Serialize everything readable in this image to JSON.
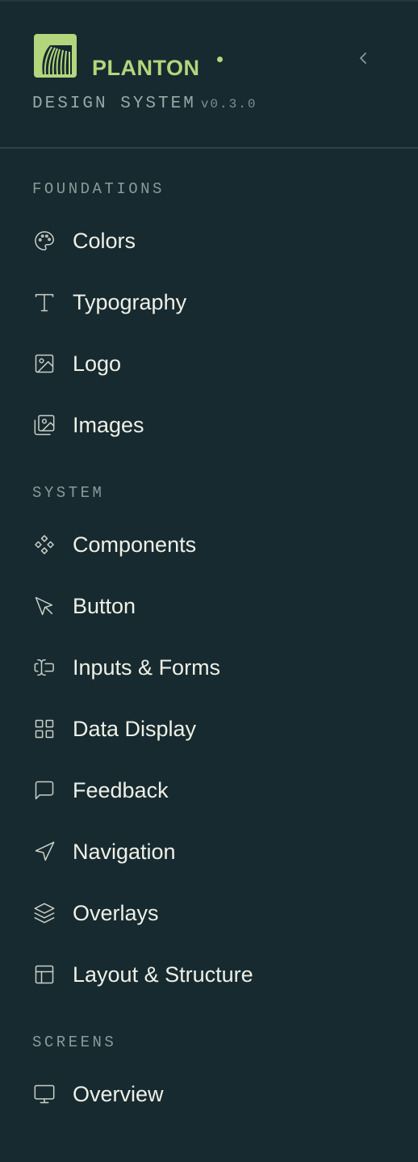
{
  "brand": {
    "name": "PLANTON",
    "subtitle": "DESIGN SYSTEM",
    "version": "v0.3.0",
    "accent_color": "#b3d67c"
  },
  "collapse": {
    "icon": "chevron-left-icon"
  },
  "sections": [
    {
      "label": "FOUNDATIONS",
      "items": [
        {
          "label": "Colors",
          "icon": "palette-icon"
        },
        {
          "label": "Typography",
          "icon": "type-icon"
        },
        {
          "label": "Logo",
          "icon": "image-icon"
        },
        {
          "label": "Images",
          "icon": "images-icon"
        }
      ]
    },
    {
      "label": "SYSTEM",
      "items": [
        {
          "label": "Components",
          "icon": "components-icon"
        },
        {
          "label": "Button",
          "icon": "pointer-icon"
        },
        {
          "label": "Inputs & Forms",
          "icon": "text-cursor-input-icon"
        },
        {
          "label": "Data Display",
          "icon": "grid-icon"
        },
        {
          "label": "Feedback",
          "icon": "message-square-icon"
        },
        {
          "label": "Navigation",
          "icon": "navigation-icon"
        },
        {
          "label": "Overlays",
          "icon": "layers-icon"
        },
        {
          "label": "Layout & Structure",
          "icon": "layout-icon"
        }
      ]
    },
    {
      "label": "SCREENS",
      "items": [
        {
          "label": "Overview",
          "icon": "monitor-icon"
        }
      ]
    }
  ],
  "colors": {
    "background": "#172a30",
    "text": "#eef0e6",
    "muted": "#8b9a99",
    "divider": "#2e4349"
  }
}
